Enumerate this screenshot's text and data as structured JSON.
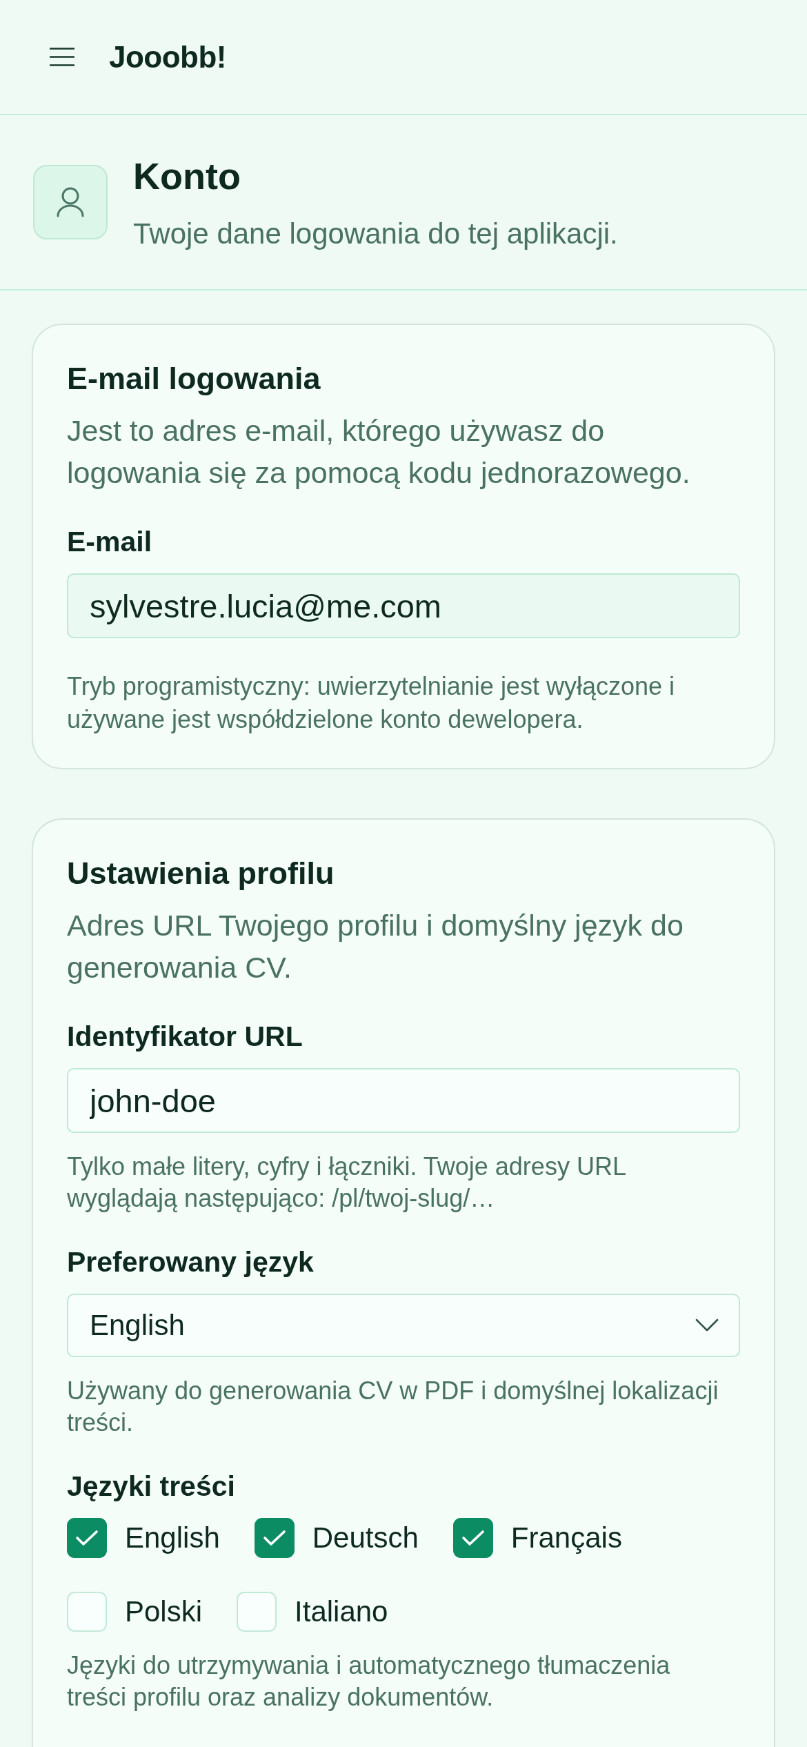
{
  "app_bar": {
    "title": "Jooobb!"
  },
  "page_header": {
    "title": "Konto",
    "subtitle": "Twoje dane logowania do tej aplikacji."
  },
  "sections": [
    {
      "title": "E-mail logowania",
      "description": "Jest to adres e-mail, którego używasz do logowania się za pomocą kodu jednorazowego.",
      "fields": [
        {
          "kind": "text",
          "label": "E-mail",
          "value": "sylvestre.lucia@me.com",
          "readonly": true
        }
      ],
      "note": "Tryb programistyczny: uwierzytelnianie jest wyłączone i używane jest współdzielone konto dewelopera."
    },
    {
      "title": "Ustawienia profilu",
      "description": "Adres URL Twojego profilu i domyślny język do generowania CV.",
      "fields": [
        {
          "kind": "text",
          "label": "Identyfikator URL",
          "value": "john-doe",
          "readonly": false,
          "hint": "Tylko małe litery, cyfry i łączniki. Twoje adresy URL wyglądają następująco: /pl/twoj-slug/…"
        },
        {
          "kind": "select",
          "label": "Preferowany język",
          "value": "English",
          "hint": "Używany do generowania CV w PDF i domyślnej lokalizacji treści."
        },
        {
          "kind": "checkboxes",
          "label": "Języki treści",
          "options": [
            {
              "label": "English",
              "checked": true
            },
            {
              "label": "Deutsch",
              "checked": true
            },
            {
              "label": "Français",
              "checked": true
            },
            {
              "label": "Polski",
              "checked": false
            },
            {
              "label": "Italiano",
              "checked": false
            }
          ],
          "hint": "Języki do utrzymywania i automatycznego tłumaczenia treści profilu oraz analizy dokumentów."
        }
      ]
    }
  ]
}
